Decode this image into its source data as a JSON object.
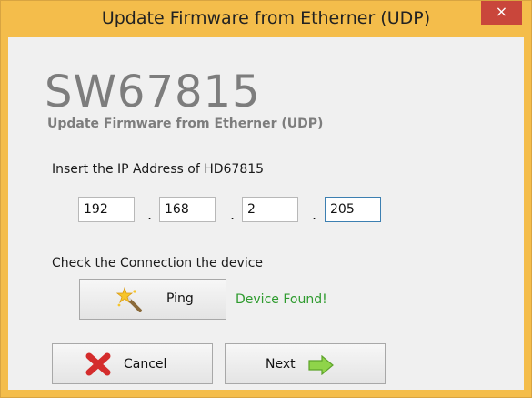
{
  "window": {
    "title": "Update Firmware from Etherner (UDP)",
    "close_glyph": "×"
  },
  "header": {
    "product": "SW67815",
    "subtitle": "Update Firmware from Etherner (UDP)"
  },
  "ip_section": {
    "label": "Insert the IP Address of  HD67815",
    "octets": [
      "192",
      "168",
      "2",
      "205"
    ],
    "separator": "."
  },
  "connection": {
    "label": "Check the Connection the device",
    "ping_label": "Ping",
    "ping_icon": "magic-wand-icon",
    "status": "Device Found!"
  },
  "footer": {
    "cancel_label": "Cancel",
    "cancel_icon": "red-x-icon",
    "next_label": "Next",
    "next_icon": "green-arrow-right-icon"
  },
  "colors": {
    "title_bar": "#f4bd4b",
    "close_button": "#c9463b",
    "status_text": "#2e9b2e",
    "heading_gray": "#7d7d7d"
  }
}
